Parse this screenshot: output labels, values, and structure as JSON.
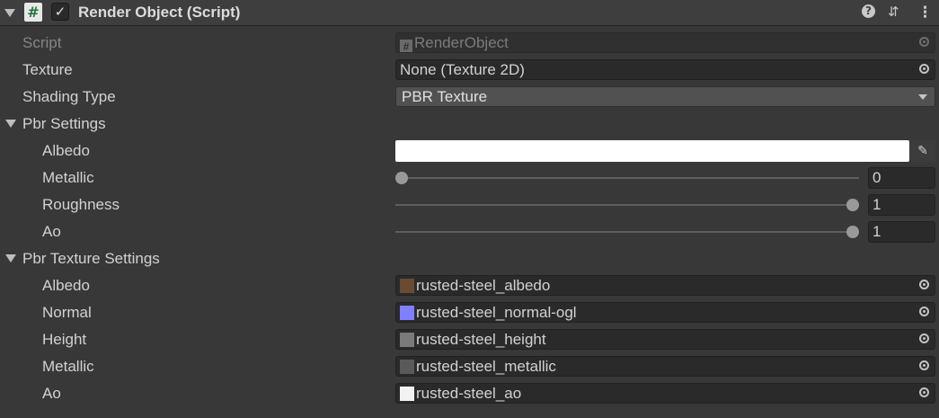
{
  "header": {
    "title": "Render Object (Script)",
    "enabled_check": "✓",
    "script_glyph": "#",
    "help_glyph": "?",
    "presets_glyph": "⇵",
    "menu_glyph": "⋮"
  },
  "script_row": {
    "label": "Script",
    "value": "RenderObject",
    "icon_glyph": "#"
  },
  "texture_row": {
    "label": "Texture",
    "value": "None (Texture 2D)"
  },
  "shading_row": {
    "label": "Shading Type",
    "value": "PBR Texture"
  },
  "pbr_settings": {
    "title": "Pbr Settings",
    "albedo_label": "Albedo",
    "albedo_color": "#ffffff",
    "eyedropper_glyph": "✎",
    "metallic": {
      "label": "Metallic",
      "value": "0",
      "fraction": 0
    },
    "roughness": {
      "label": "Roughness",
      "value": "1",
      "fraction": 1
    },
    "ao": {
      "label": "Ao",
      "value": "1",
      "fraction": 1
    }
  },
  "pbr_texture_settings": {
    "title": "Pbr Texture Settings",
    "rows": [
      {
        "label": "Albedo",
        "value": "rusted-steel_albedo",
        "thumb_color": "#6b4a33"
      },
      {
        "label": "Normal",
        "value": "rusted-steel_normal-ogl",
        "thumb_color": "#8080ff"
      },
      {
        "label": "Height",
        "value": "rusted-steel_height",
        "thumb_color": "#7a7a7a"
      },
      {
        "label": "Metallic",
        "value": "rusted-steel_metallic",
        "thumb_color": "#5a5a5a"
      },
      {
        "label": "Ao",
        "value": "rusted-steel_ao",
        "thumb_color": "#f2f2f2"
      }
    ]
  }
}
